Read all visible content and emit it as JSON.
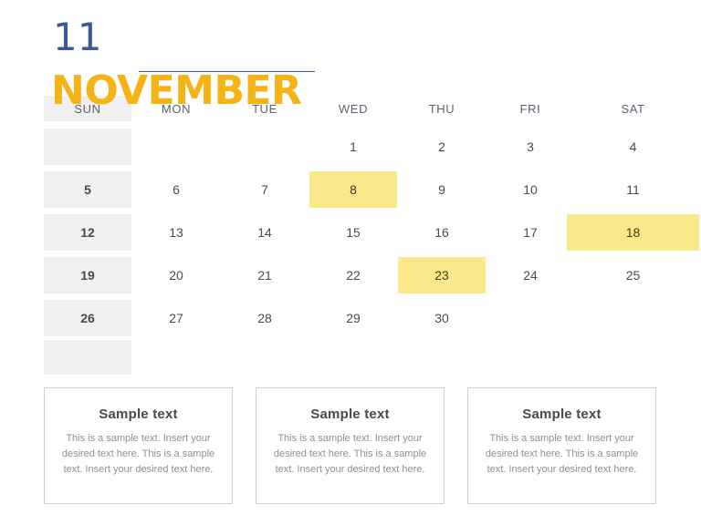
{
  "header": {
    "month_number": "11",
    "month_name": "NOVEMBER",
    "rule_color": "#3D5A96",
    "month_number_color": "#3D5A96",
    "month_name_color": "#F5B315"
  },
  "calendar": {
    "weekdays": [
      "SUN",
      "MON",
      "TUE",
      "WED",
      "THU",
      "FRI",
      "SAT"
    ],
    "sunday_panel_color": "#F0F0F0",
    "highlight_color": "#FAE98A",
    "weeks": [
      [
        {
          "day": "",
          "highlight": false
        },
        {
          "day": "",
          "highlight": false
        },
        {
          "day": "",
          "highlight": false
        },
        {
          "day": "1",
          "highlight": false
        },
        {
          "day": "2",
          "highlight": false
        },
        {
          "day": "3",
          "highlight": false
        },
        {
          "day": "4",
          "highlight": false
        }
      ],
      [
        {
          "day": "5",
          "highlight": false
        },
        {
          "day": "6",
          "highlight": false
        },
        {
          "day": "7",
          "highlight": false
        },
        {
          "day": "8",
          "highlight": true
        },
        {
          "day": "9",
          "highlight": false
        },
        {
          "day": "10",
          "highlight": false
        },
        {
          "day": "11",
          "highlight": false
        }
      ],
      [
        {
          "day": "12",
          "highlight": false
        },
        {
          "day": "13",
          "highlight": false
        },
        {
          "day": "14",
          "highlight": false
        },
        {
          "day": "15",
          "highlight": false
        },
        {
          "day": "16",
          "highlight": false
        },
        {
          "day": "17",
          "highlight": false
        },
        {
          "day": "18",
          "highlight": true
        }
      ],
      [
        {
          "day": "19",
          "highlight": false
        },
        {
          "day": "20",
          "highlight": false
        },
        {
          "day": "21",
          "highlight": false
        },
        {
          "day": "22",
          "highlight": false
        },
        {
          "day": "23",
          "highlight": true
        },
        {
          "day": "24",
          "highlight": false
        },
        {
          "day": "25",
          "highlight": false
        }
      ],
      [
        {
          "day": "26",
          "highlight": false
        },
        {
          "day": "27",
          "highlight": false
        },
        {
          "day": "28",
          "highlight": false
        },
        {
          "day": "29",
          "highlight": false
        },
        {
          "day": "30",
          "highlight": false
        },
        {
          "day": "",
          "highlight": false
        },
        {
          "day": "",
          "highlight": false
        }
      ],
      [
        {
          "day": "",
          "highlight": false
        },
        {
          "day": "",
          "highlight": false
        },
        {
          "day": "",
          "highlight": false
        },
        {
          "day": "",
          "highlight": false
        },
        {
          "day": "",
          "highlight": false
        },
        {
          "day": "",
          "highlight": false
        },
        {
          "day": "",
          "highlight": false
        }
      ]
    ]
  },
  "cards": [
    {
      "title": "Sample text",
      "body": "This is a sample text. Insert your desired text here. This is a sample text. Insert your desired text here."
    },
    {
      "title": "Sample text",
      "body": "This is a sample text. Insert your desired text here. This is a sample text. Insert your desired text here."
    },
    {
      "title": "Sample text",
      "body": "This is a sample text. Insert your desired text here. This is a sample text. Insert your desired text here."
    }
  ]
}
